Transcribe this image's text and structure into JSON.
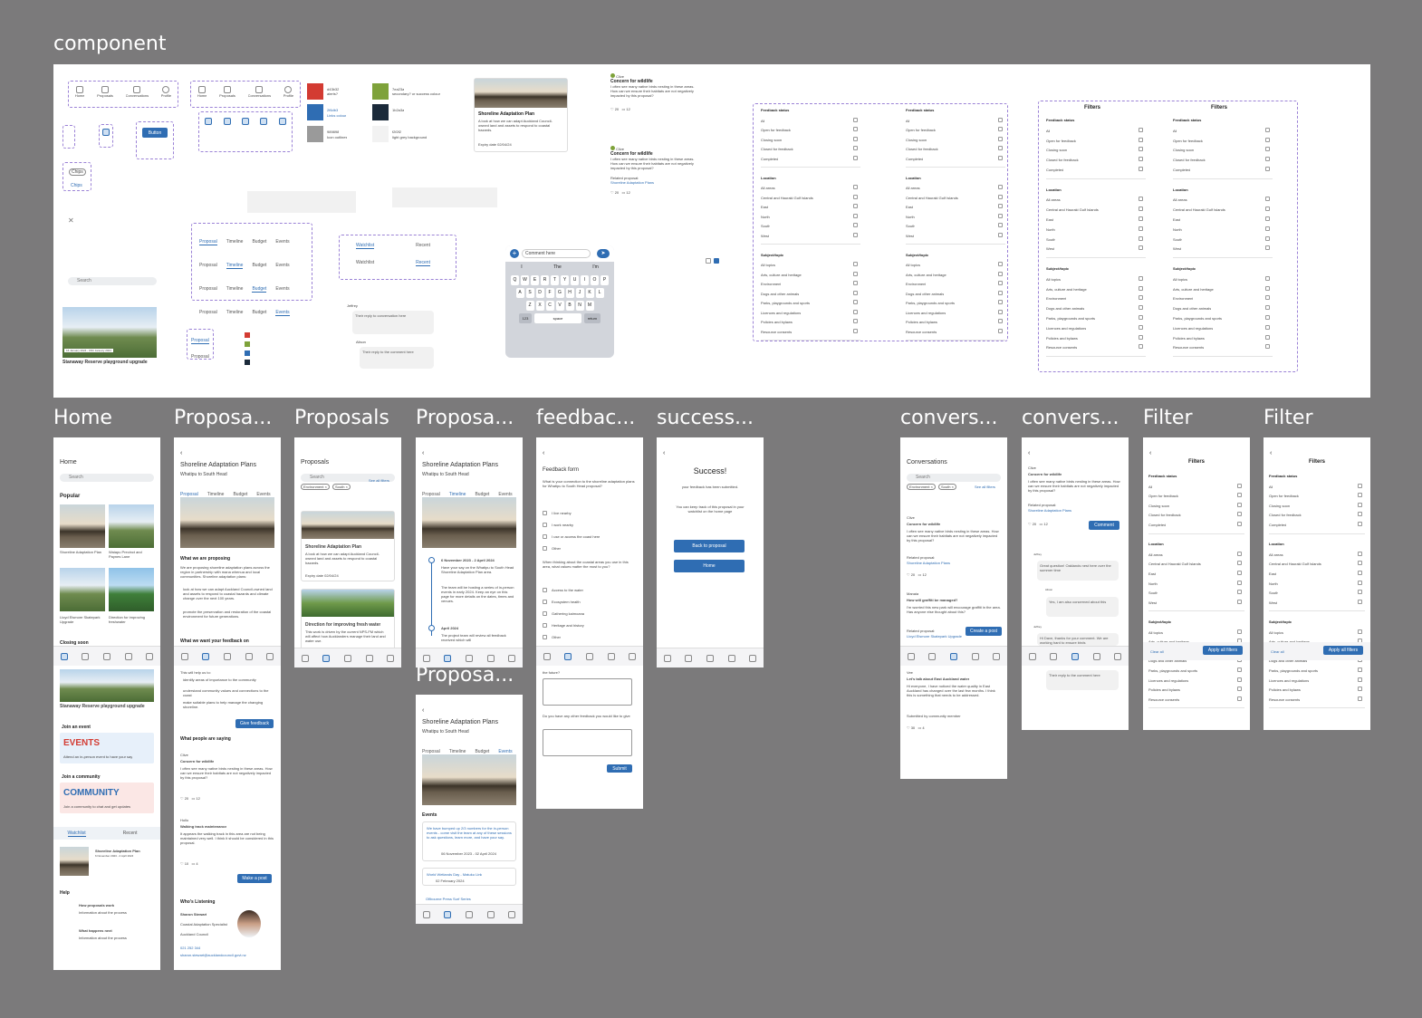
{
  "labels": {
    "component": "component",
    "home": "Home",
    "proposa1": "Proposa...",
    "proposals": "Proposals",
    "proposa2": "Proposa...",
    "feedback": "feedbac...",
    "success": "success...",
    "convers1": "convers...",
    "convers2": "convers...",
    "filter1": "Filter",
    "filter2": "Filter",
    "proposa3": "Proposa..."
  },
  "colors": {
    "red": "#d33b32",
    "blue": "#2f6db3",
    "gray": "#9a9a9a",
    "green": "#7ea23a",
    "navy": "#1b2a3a",
    "light": "#f2f2f2"
  },
  "swatches": [
    {
      "hex": "d43b32",
      "name": "alerts?"
    },
    {
      "hex": "2f6db3",
      "name": "Links colour"
    },
    {
      "hex": "989898",
      "name": "Icon outlines"
    },
    {
      "hex": "7ea23a",
      "name": "secondary? or success colour"
    },
    {
      "hex": "1b2a3a",
      "name": ""
    },
    {
      "hex": "f2f2f2",
      "name": "light grey background"
    }
  ],
  "nav": [
    "Home",
    "Proposals",
    "Conversations",
    "Profile"
  ],
  "button_label": "Button",
  "chips_label": "Chips",
  "search_placeholder": "Search",
  "tabs": [
    "Proposal",
    "Timeline",
    "Budget",
    "Events"
  ],
  "watch_tabs": [
    "Watchlist",
    "Recent"
  ],
  "park_title": "Stanaway Reserve playground upgrade",
  "park_dates": "16 January 2024 - 15th January 2024",
  "proposal_card": {
    "title": "Shoreline Adaptation Plan",
    "desc": "A look at how we can adapt Auckland Council-owned land and assets to respond to coastal hazards.",
    "expiry": "Expiry date 02/04/24"
  },
  "comments": [
    {
      "user": "Clive",
      "title": "Concern for wildlife",
      "body": "I often see many native birds nesting in these areas. How can we ensure their habitats are not negatively impacted by this proposal?",
      "likes": "20",
      "replies": "12"
    },
    {
      "user": "Clive",
      "title": "Concern for wildlife",
      "body": "I often see many native birds nesting in these areas. How can we ensure their habitats are not negatively impacted by this proposal?",
      "related": "Related proposal:",
      "link": "Shoreline Adaptation Plans",
      "likes": "20",
      "replies": "12"
    }
  ],
  "filters": {
    "title": "Filters",
    "feedback_status": "Feedback status",
    "status_items": [
      "All",
      "Open for feedback",
      "Closing soon",
      "Closed for feedback",
      "Completed"
    ],
    "location": "Location",
    "location_items": [
      "All areas",
      "Central and Hauraki Gulf Islands",
      "East",
      "North",
      "South",
      "West"
    ],
    "subject": "Subject/topic",
    "subject_items": [
      "All topics",
      "Arts, culture and heritage",
      "Environment",
      "Dogs and other animals",
      "Parks, playgrounds and sports",
      "Licences and regulations",
      "Policies and bylaws",
      "Resource consents"
    ],
    "clear": "Clear all",
    "apply": "Apply all filters"
  },
  "keyboard": {
    "placeholder": "Comment here",
    "suggest": [
      "I",
      "The",
      "I'm"
    ],
    "row1": [
      "Q",
      "W",
      "E",
      "R",
      "T",
      "Y",
      "U",
      "I",
      "O",
      "P"
    ],
    "row2": [
      "A",
      "S",
      "D",
      "F",
      "G",
      "H",
      "J",
      "K",
      "L"
    ],
    "row3": [
      "Z",
      "X",
      "C",
      "V",
      "B",
      "N",
      "M"
    ],
    "num": "123",
    "space": "space",
    "ret": "return"
  },
  "replies": [
    {
      "user": "Jeffrey",
      "text": "Their reply to conversation here"
    },
    {
      "user": "Alison",
      "text": "Their reply to the comment here"
    }
  ],
  "home": {
    "title": "Home",
    "search": "Search",
    "popular": "Popular",
    "tile1": "Shoreline Adaptation Plan",
    "tile2": "Waiapu Precinct and Paynes Lane",
    "tile3": "Lloyd Elsmore Skatepark Upgrade",
    "tile4": "Direction for improving freshwater",
    "closing": "Closing soon",
    "park": "Stanaway Reserve playground upgrade",
    "event_h": "Join an event",
    "events": "EVENTS",
    "events_sub": "Attend an in-person event to have your say",
    "comm_h": "Join a community",
    "community": "COMMUNITY",
    "comm_sub": "Join a community to chat and get updates",
    "watch_title": "Shoreline Adaptation Plan",
    "watch_date": "6 November 2023 - 2 April 2024",
    "help": "Help",
    "help1": "How proposals work",
    "help1_sub": "Information about the process",
    "help2": "What happens next",
    "help2_sub": "Information about the process"
  },
  "proposal": {
    "title": "Shoreline Adaptation Plans",
    "sub": "Whatipu to South Head",
    "h1": "What we are proposing",
    "p1": "We are proposing shoreline adaptation plans across the region in partnership with mana whenua and local communities. Shoreline adaptation plans:",
    "b1": "look at how we can adapt Auckland Council-owned land and assets to respond to coastal hazards and climate change over the next 100 years.",
    "b2": "promote the preservation and restoration of the coastal environment for future generations.",
    "h2": "What we want your feedback on",
    "p2": "This will help us to:",
    "b3": "identify areas of importance to the community",
    "b4": "understand community values and connections to the coast",
    "b5": "make suitable plans to help manage the changing shoreline.",
    "give": "Give feedback",
    "saying": "What people are saying",
    "c2_user": "Hollo",
    "c2_title": "Walking track maintenance",
    "c2_body": "It appears the walking track in this area are not being maintained very well. I think it should be considered in this proposal.",
    "c2_likes": "10",
    "c2_replies": "4",
    "make_post": "Make a post",
    "listening": "Who's Listening",
    "name": "Sharon Stewart",
    "role": "Coastal Adaptation Specialist",
    "org": "Auckland Council",
    "phone": "021 252 344",
    "email": "sharon.stewart@aucklandcouncil.govt.nz"
  },
  "proposals_list": {
    "title": "Proposals",
    "chip1": "Environment ×",
    "chip2": "South ×",
    "see_all": "See all filters",
    "card2": "Direction for improving fresh water",
    "card2_desc": "This work is driven by the current NPS-FM which will affect how Aucklanders manage their land and water use."
  },
  "timeline": {
    "d1": "6 November 2023 - 2 April 2024",
    "t1": "Have your say on the Whatipu to South Head Shoreline Adaptation Plan area.",
    "t2": "The team will be hosting a series of in-person events in early 2024. Keep an eye on this page for more details on the dates, times and venues.",
    "d2": "April 2024",
    "t3": "The project team will review all feedback received which will"
  },
  "events_screen": {
    "h": "Events",
    "e1": "We have bumped up 2/3 numbers for the in-person events - come visit the team at any of these sessions to ask questions, learn more, and have your say.",
    "e1_date": "06 November 2023 - 02 April 2024",
    "e2": "World Wetlands Day - Matuku Link",
    "e2_date": "02 February 2024",
    "e3": "Oflbourne Press Surf Series"
  },
  "feedback_form": {
    "title": "Feedback form",
    "q1": "What is your connection to the shoreline adaptation plans for Whatipu to South Head proposal?",
    "o1": [
      "I live nearby",
      "I work nearby",
      "I use or access the coast here",
      "Other"
    ],
    "q2": "When thinking about the coastal areas you use in this area, what values matter the most to you?",
    "o2": [
      "Access to the water",
      "Ecosystem health",
      "Gathering kaimoana",
      "Heritage and history",
      "Other"
    ],
    "q3": "the future?",
    "q4": "Do you have any other feedback you would like to give",
    "submit": "Submit"
  },
  "success_screen": {
    "title": "Success!",
    "p1": "your feedback has been submitted.",
    "p2": "You can keep track of this proposal in your watchlist on the home page",
    "b1": "Back to proposal",
    "b2": "Home"
  },
  "conversations": {
    "title": "Conversations",
    "search": "Search",
    "see_all": "See all filters",
    "chip1": "Environment ×",
    "chip2": "South ×",
    "c2_user": "Manaia",
    "c2_title": "How will graffiti be managed?",
    "c2_body": "I'm worried this new park will encourage graffiti in the area. Has anyone else thought about this?",
    "c2_related": "Related proposal:",
    "c2_link": "Lloyd Elsmore Skatepark Upgrade",
    "create": "Create a post",
    "c3_user": "Vee",
    "c3_title": "Let's talk about East Auckland water",
    "c3_body": "Hi everyone, I have noticed the water quality in East Auckland has changed over the last few months. I think this is something that needs to be addressed.",
    "c3_sub": "Submitted by community member",
    "c3_likes": "30",
    "c3_replies": "4"
  },
  "thread": {
    "comment_btn": "Comment",
    "r1_user": "Jeffrey",
    "r1": "Great question! Oaklands nest here over the summer time",
    "r2_user": "Alison",
    "r2": "Yes, I am also concerned about this",
    "r3_user": "Jeffrey",
    "r3": "Hi Dave, thanks for your comment. We are working hard to ensure birds"
  }
}
